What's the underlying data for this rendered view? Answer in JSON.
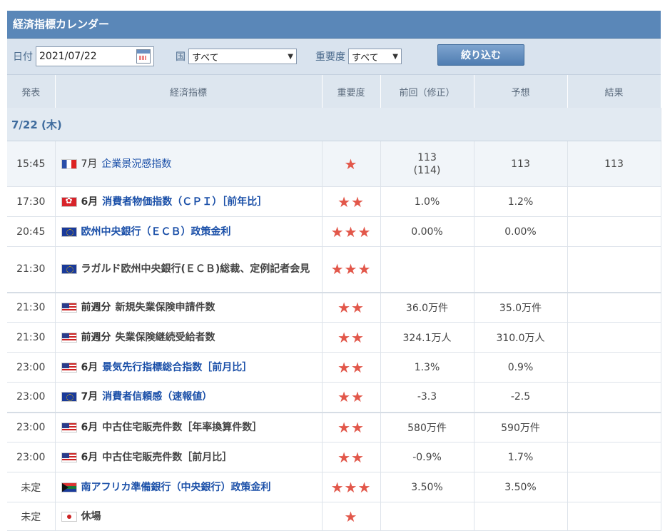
{
  "title": "経済指標カレンダー",
  "filter": {
    "date_label": "日付",
    "date_value": "2021/07/22",
    "country_label": "国",
    "country_value": "すべて",
    "importance_label": "重要度",
    "importance_value": "すべて",
    "submit_label": "絞り込む"
  },
  "columns": [
    "発表",
    "経済指標",
    "重要度",
    "前回（修正）",
    "予想",
    "結果"
  ],
  "date_header": "7/22 (木)",
  "rows": [
    {
      "time": "15:45",
      "flag": "fr",
      "period": "7月",
      "name": "企業景況感指数",
      "bold": false,
      "link": true,
      "stars": "★",
      "prev": "113",
      "prev_rev": "(114)",
      "forecast": "113",
      "result": "113"
    },
    {
      "time": "17:30",
      "flag": "hk",
      "period": "6月",
      "name": "消費者物価指数（ＣＰＩ）［前年比］",
      "bold": true,
      "link": true,
      "stars": "★★",
      "prev": "1.0%",
      "prev_rev": "",
      "forecast": "1.2%",
      "result": ""
    },
    {
      "time": "20:45",
      "flag": "eu",
      "period": "",
      "name": "欧州中央銀行（ＥＣＢ）政策金利",
      "bold": true,
      "link": true,
      "stars": "★★★",
      "prev": "0.00%",
      "prev_rev": "",
      "forecast": "0.00%",
      "result": ""
    },
    {
      "time": "21:30",
      "flag": "eu",
      "period": "",
      "name": "ラガルド欧州中央銀行(ＥＣＢ)総裁、定例記者会見",
      "bold": true,
      "link": false,
      "stars": "★★★",
      "prev": "",
      "prev_rev": "",
      "forecast": "",
      "result": ""
    },
    {
      "time": "21:30",
      "flag": "us",
      "period": "前週分",
      "name": "新規失業保険申請件数",
      "bold": true,
      "link": false,
      "stars": "★★",
      "prev": "36.0万件",
      "prev_rev": "",
      "forecast": "35.0万件",
      "result": ""
    },
    {
      "time": "21:30",
      "flag": "us",
      "period": "前週分",
      "name": "失業保険継続受給者数",
      "bold": true,
      "link": false,
      "stars": "★★",
      "prev": "324.1万人",
      "prev_rev": "",
      "forecast": "310.0万人",
      "result": ""
    },
    {
      "time": "23:00",
      "flag": "us",
      "period": "6月",
      "name": "景気先行指標総合指数［前月比］",
      "bold": true,
      "link": true,
      "stars": "★★",
      "prev": "1.3%",
      "prev_rev": "",
      "forecast": "0.9%",
      "result": ""
    },
    {
      "time": "23:00",
      "flag": "eu",
      "period": "7月",
      "name": "消費者信頼感（速報値）",
      "bold": true,
      "link": true,
      "stars": "★★",
      "prev": "-3.3",
      "prev_rev": "",
      "forecast": "-2.5",
      "result": ""
    },
    {
      "time": "23:00",
      "flag": "us",
      "period": "6月",
      "name": "中古住宅販売件数［年率換算件数］",
      "bold": true,
      "link": false,
      "stars": "★★",
      "prev": "580万件",
      "prev_rev": "",
      "forecast": "590万件",
      "result": ""
    },
    {
      "time": "23:00",
      "flag": "us",
      "period": "6月",
      "name": "中古住宅販売件数［前月比］",
      "bold": true,
      "link": false,
      "stars": "★★",
      "prev": "-0.9%",
      "prev_rev": "",
      "forecast": "1.7%",
      "result": ""
    },
    {
      "time": "未定",
      "flag": "za",
      "period": "",
      "name": "南アフリカ準備銀行（中央銀行）政策金利",
      "bold": true,
      "link": true,
      "stars": "★★★",
      "prev": "3.50%",
      "prev_rev": "",
      "forecast": "3.50%",
      "result": ""
    },
    {
      "time": "未定",
      "flag": "jp",
      "period": "",
      "name": "休場",
      "bold": true,
      "link": false,
      "stars": "★",
      "prev": "",
      "prev_rev": "",
      "forecast": "",
      "result": ""
    }
  ]
}
